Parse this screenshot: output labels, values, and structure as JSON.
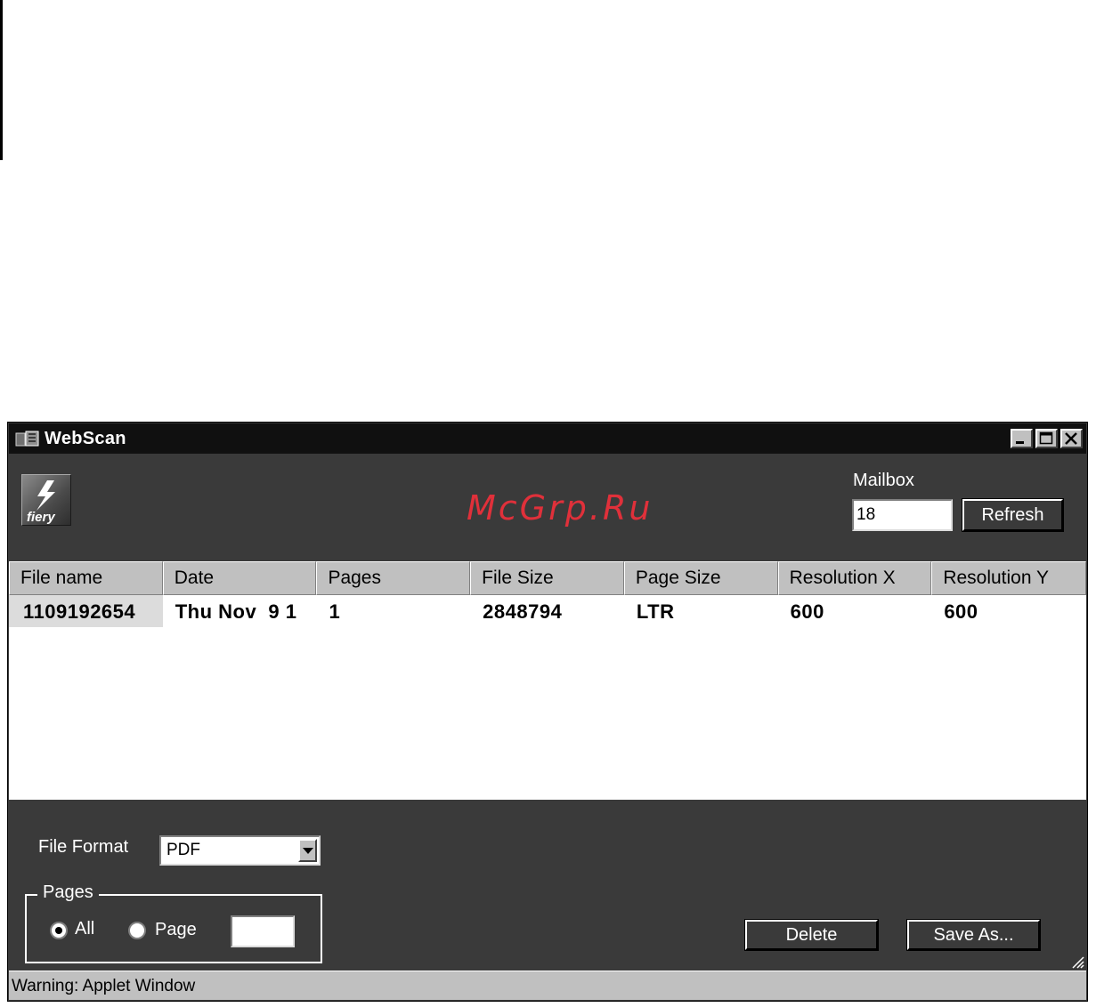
{
  "window": {
    "title": "WebScan",
    "watermark": "McGrp.Ru",
    "logo_text": "fiery"
  },
  "mailbox": {
    "label": "Mailbox",
    "value": "18",
    "refresh_label": "Refresh"
  },
  "table": {
    "columns": [
      "File name",
      "Date",
      "Pages",
      "File Size",
      "Page Size",
      "Resolution X",
      "Resolution Y"
    ],
    "rows": [
      [
        "1109192654",
        "Thu Nov  9 1",
        "1",
        "2848794",
        "LTR",
        "600",
        "600"
      ]
    ]
  },
  "bottom": {
    "file_format_label": "File Format",
    "file_format_value": "PDF",
    "pages_group_label": "Pages",
    "radio_all": "All",
    "radio_page": "Page",
    "page_value": "",
    "delete_label": "Delete",
    "save_as_label": "Save As..."
  },
  "status": {
    "text": "Warning: Applet Window"
  }
}
